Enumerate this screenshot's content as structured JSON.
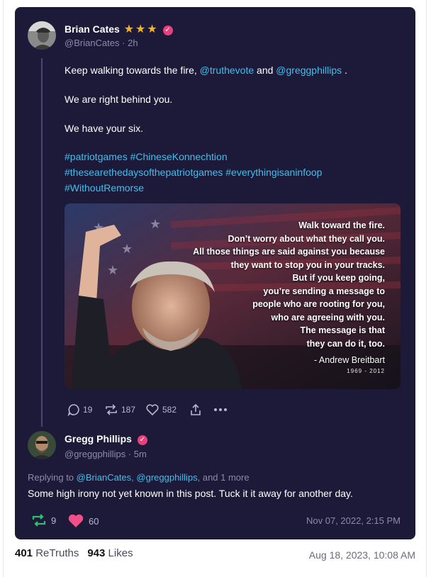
{
  "original_post": {
    "author_name": "Brian Cates",
    "author_handle": "@BrianCates",
    "time_ago": "2h",
    "text_prefix": "Keep walking towards the fire, ",
    "mention_1": "@truthevote",
    "text_mid": " and ",
    "mention_2": "@greggphillips",
    "text_suffix": " .",
    "line2": "We are right behind you.",
    "line3": "We have your six.",
    "hashtags_line1": "#patriotgames #ChineseKonnechtion",
    "hashtags_line2": "#thesearethedaysofthepatriotgames #everythingisaninfoop",
    "hashtags_line3": "#WithoutRemorse",
    "image": {
      "quote_lines": [
        "Walk toward the fire.",
        "Don’t worry about what they call you.",
        "All those things are said against you because",
        "they want to stop you in your tracks.",
        "But if you keep going,",
        "you’re sending a message to",
        "people who are rooting for you,",
        "who are agreeing with you.",
        "The message is that",
        "they can do it, too."
      ],
      "author": "- Andrew Breitbart",
      "years": "1969 - 2012"
    },
    "actions": {
      "replies": "19",
      "retruths": "187",
      "likes": "582"
    }
  },
  "reply": {
    "author_name": "Gregg Phillips",
    "author_handle": "@greggphillips",
    "time_ago": "5m",
    "replying_label": "Replying to ",
    "replying_to_1": "@BrianCates",
    "replying_sep": ", ",
    "replying_to_2": "@greggphillips",
    "replying_more": ", and 1 more",
    "text": "Some high irony not yet known in this post. Tuck it it away for another day.",
    "retruths": "9",
    "likes": "60",
    "date": "Nov 07, 2022, 2:15 PM"
  },
  "footer": {
    "retruths_count": "401",
    "retruths_label": "ReTruths",
    "likes_count": "943",
    "likes_label": "Likes",
    "date": "Aug 18, 2023, 10:08 AM"
  },
  "colors": {
    "card_bg": "#1c1a38",
    "link": "#3ec0f0",
    "star": "#f5b324",
    "verified": "#e8407a",
    "retruth_green": "#2fbf71",
    "heart_pink": "#f0508a"
  }
}
